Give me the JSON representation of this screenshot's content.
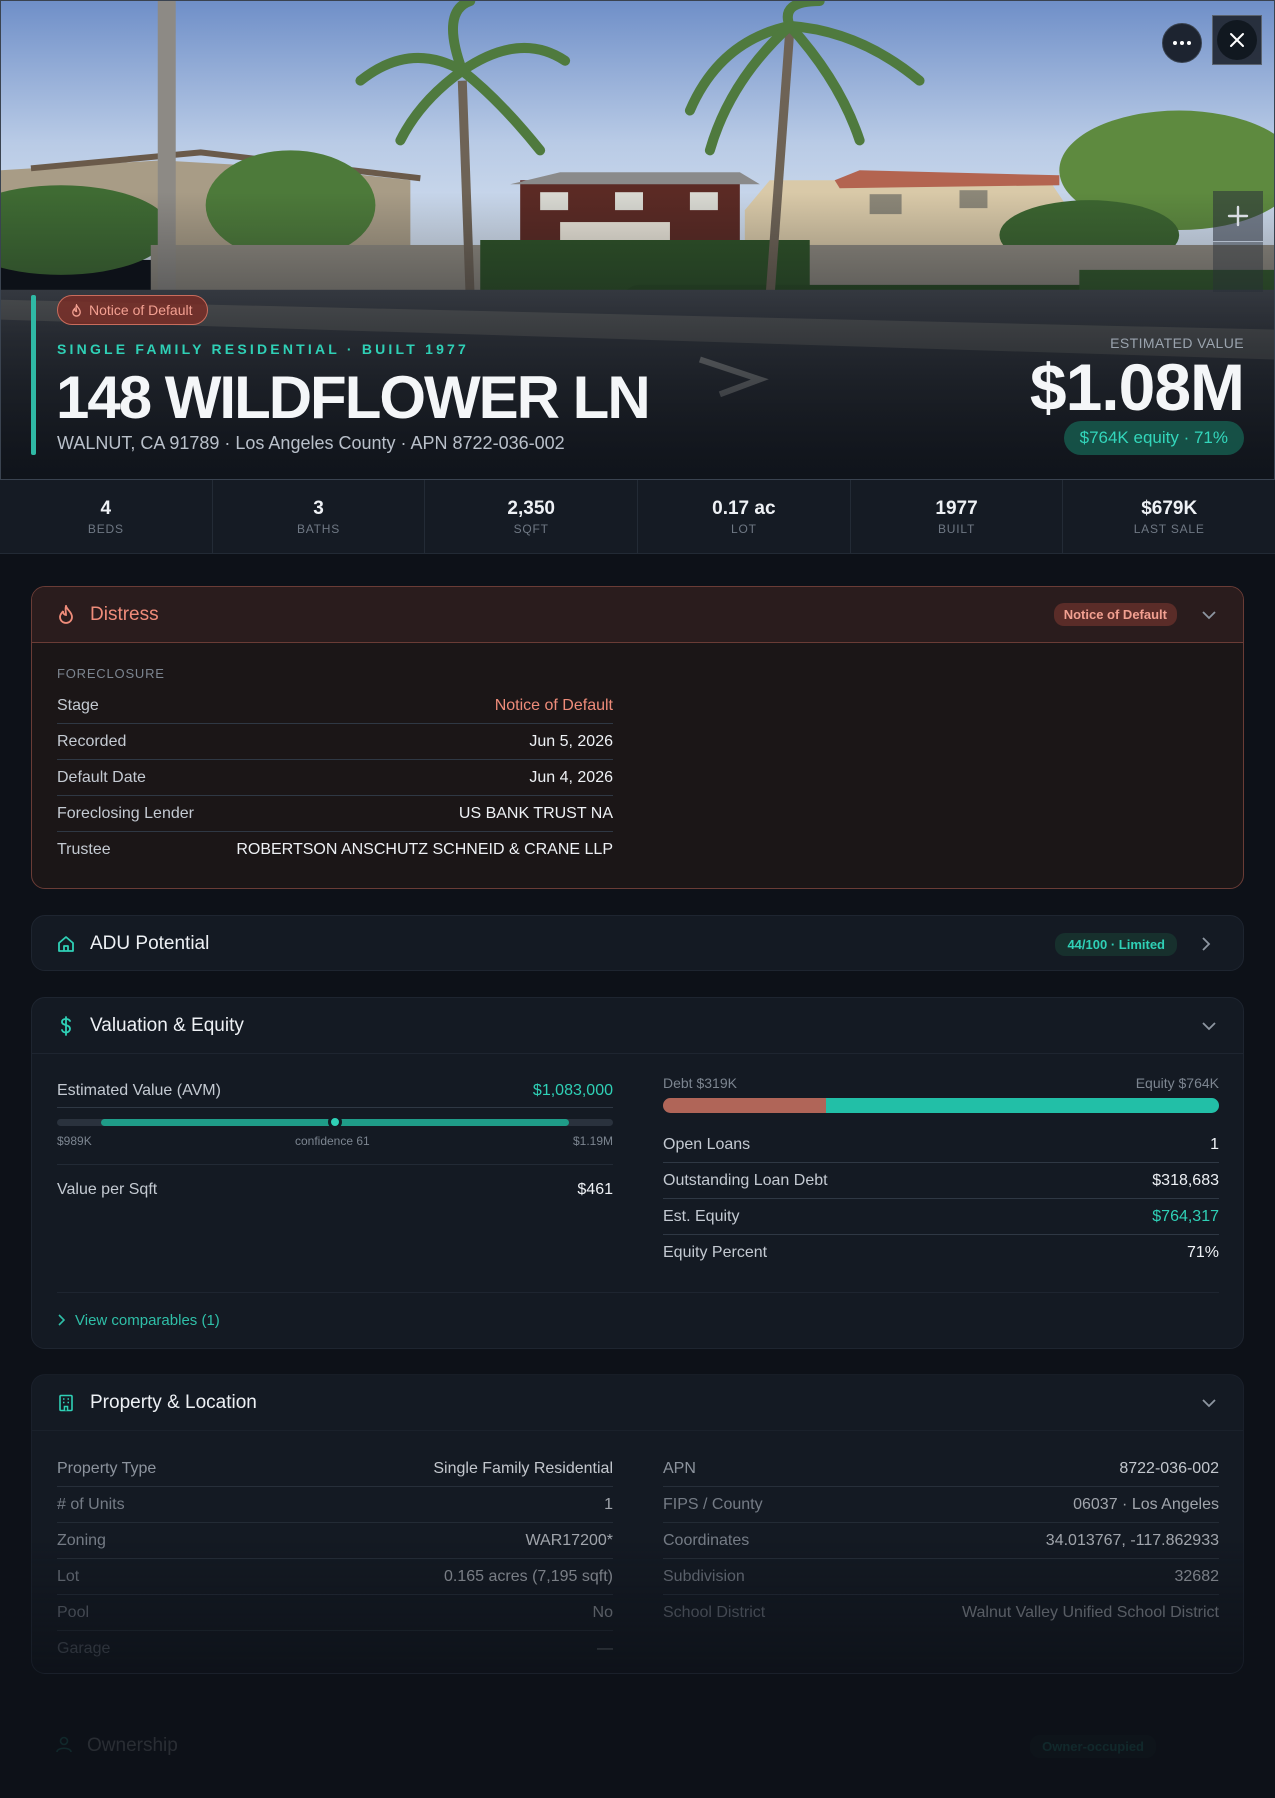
{
  "hero": {
    "badge": "Notice of Default",
    "subtitle": "SINGLE FAMILY RESIDENTIAL · BUILT 1977",
    "title": "148 WILDFLOWER LN",
    "address": "WALNUT, CA 91789 · Los Angeles County · APN 8722-036-002",
    "estimated_label": "ESTIMATED VALUE",
    "estimated_value": "$1.08M",
    "equity_pill": "$764K equity · 71%"
  },
  "stats": [
    {
      "value": "4",
      "label": "BEDS"
    },
    {
      "value": "3",
      "label": "BATHS"
    },
    {
      "value": "2,350",
      "label": "SQFT"
    },
    {
      "value": "0.17 ac",
      "label": "LOT"
    },
    {
      "value": "1977",
      "label": "BUILT"
    },
    {
      "value": "$679K",
      "label": "LAST SALE"
    }
  ],
  "distress": {
    "title": "Distress",
    "badge": "Notice of Default",
    "section_label": "FORECLOSURE",
    "rows": [
      {
        "k": "Stage",
        "v": "Notice of Default"
      },
      {
        "k": "Recorded",
        "v": "Jun 5, 2026"
      },
      {
        "k": "Default Date",
        "v": "Jun 4, 2026"
      },
      {
        "k": "Foreclosing Lender",
        "v": "US BANK TRUST NA"
      },
      {
        "k": "Trustee",
        "v": "ROBERTSON ANSCHUTZ SCHNEID & CRANE LLP"
      }
    ]
  },
  "adu": {
    "title": "ADU Potential",
    "badge": "44/100 · Limited"
  },
  "valuation": {
    "title": "Valuation & Equity",
    "avm_label": "Estimated Value (AVM)",
    "avm_value": "$1,083,000",
    "range_low": "$989K",
    "range_mid": "confidence 61",
    "range_high": "$1.19M",
    "range_low_frac": 0.08,
    "range_high_frac": 0.92,
    "range_point_frac": 0.5,
    "vps_label": "Value per Sqft",
    "vps_value": "$461",
    "debt_label": "Debt $319K",
    "equity_label": "Equity $764K",
    "debt_frac": 0.294,
    "rows": [
      {
        "k": "Open Loans",
        "v": "1"
      },
      {
        "k": "Outstanding Loan Debt",
        "v": "$318,683"
      },
      {
        "k": "Est. Equity",
        "v": "$764,317"
      },
      {
        "k": "Equity Percent",
        "v": "71%"
      }
    ],
    "comps_link": "View comparables (1)"
  },
  "property": {
    "title": "Property & Location",
    "left": [
      {
        "k": "Property Type",
        "v": "Single Family Residential"
      },
      {
        "k": "# of Units",
        "v": "1"
      },
      {
        "k": "Zoning",
        "v": "WAR17200*"
      },
      {
        "k": "Lot",
        "v": "0.165 acres (7,195 sqft)"
      },
      {
        "k": "Pool",
        "v": "No"
      },
      {
        "k": "Garage",
        "v": "—"
      }
    ],
    "right": [
      {
        "k": "APN",
        "v": "8722-036-002"
      },
      {
        "k": "FIPS / County",
        "v": "06037 · Los Angeles"
      },
      {
        "k": "Coordinates",
        "v": "34.013767, -117.862933"
      },
      {
        "k": "Subdivision",
        "v": "32682"
      },
      {
        "k": "School District",
        "v": "Walnut Valley Unified School District"
      }
    ]
  },
  "ownership": {
    "title": "Ownership",
    "badge": "Owner-occupied"
  },
  "colors": {
    "accent": "#2fd0b6",
    "distress": "#ef8c7a",
    "debt": "#b06558",
    "equity": "#22bfa7"
  }
}
